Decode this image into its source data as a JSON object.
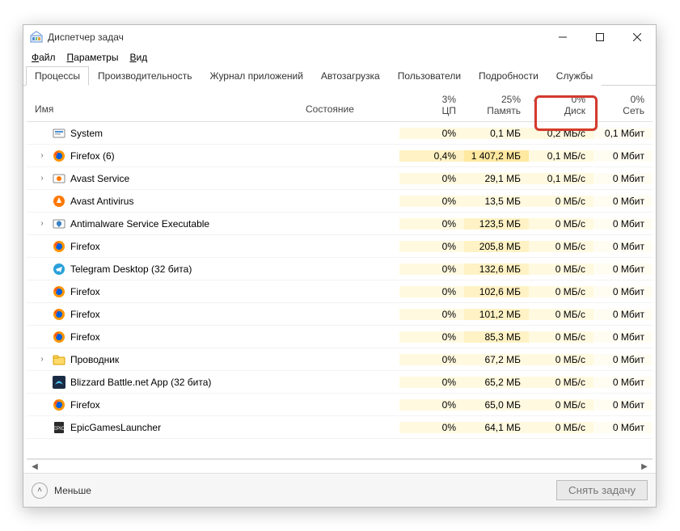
{
  "window": {
    "title": "Диспетчер задач"
  },
  "menu": {
    "file": "Файл",
    "options": "Параметры",
    "view": "Вид"
  },
  "tabs": {
    "processes": "Процессы",
    "performance": "Производительность",
    "app_history": "Журнал приложений",
    "startup": "Автозагрузка",
    "users": "Пользователи",
    "details": "Подробности",
    "services": "Службы"
  },
  "columns": {
    "name": "Имя",
    "status": "Состояние",
    "cpu_pct": "3%",
    "cpu_label": "ЦП",
    "mem_pct": "25%",
    "mem_label": "Память",
    "disk_pct": "0%",
    "disk_label": "Диск",
    "net_pct": "0%",
    "net_label": "Сеть"
  },
  "footer": {
    "fewer": "Меньше",
    "end_task": "Снять задачу"
  },
  "processes": [
    {
      "expand": false,
      "icon": "system",
      "name": "System",
      "cpu": "0%",
      "mem": "0,1 МБ",
      "disk": "0,2 МБ/с",
      "net": "0,1 Мбит"
    },
    {
      "expand": true,
      "icon": "firefox",
      "name": "Firefox (6)",
      "cpu": "0,4%",
      "mem": "1 407,2 МБ",
      "disk": "0,1 МБ/с",
      "net": "0 Мбит"
    },
    {
      "expand": true,
      "icon": "avastsvc",
      "name": "Avast Service",
      "cpu": "0%",
      "mem": "29,1 МБ",
      "disk": "0,1 МБ/с",
      "net": "0 Мбит"
    },
    {
      "expand": false,
      "icon": "avast",
      "name": "Avast Antivirus",
      "cpu": "0%",
      "mem": "13,5 МБ",
      "disk": "0 МБ/с",
      "net": "0 Мбит"
    },
    {
      "expand": true,
      "icon": "antimal",
      "name": "Antimalware Service Executable",
      "cpu": "0%",
      "mem": "123,5 МБ",
      "disk": "0 МБ/с",
      "net": "0 Мбит"
    },
    {
      "expand": false,
      "icon": "firefox",
      "name": "Firefox",
      "cpu": "0%",
      "mem": "205,8 МБ",
      "disk": "0 МБ/с",
      "net": "0 Мбит"
    },
    {
      "expand": false,
      "icon": "telegram",
      "name": "Telegram Desktop (32 бита)",
      "cpu": "0%",
      "mem": "132,6 МБ",
      "disk": "0 МБ/с",
      "net": "0 Мбит"
    },
    {
      "expand": false,
      "icon": "firefox",
      "name": "Firefox",
      "cpu": "0%",
      "mem": "102,6 МБ",
      "disk": "0 МБ/с",
      "net": "0 Мбит"
    },
    {
      "expand": false,
      "icon": "firefox",
      "name": "Firefox",
      "cpu": "0%",
      "mem": "101,2 МБ",
      "disk": "0 МБ/с",
      "net": "0 Мбит"
    },
    {
      "expand": false,
      "icon": "firefox",
      "name": "Firefox",
      "cpu": "0%",
      "mem": "85,3 МБ",
      "disk": "0 МБ/с",
      "net": "0 Мбит"
    },
    {
      "expand": true,
      "icon": "explorer",
      "name": "Проводник",
      "cpu": "0%",
      "mem": "67,2 МБ",
      "disk": "0 МБ/с",
      "net": "0 Мбит"
    },
    {
      "expand": false,
      "icon": "blizzard",
      "name": "Blizzard Battle.net App (32 бита)",
      "cpu": "0%",
      "mem": "65,2 МБ",
      "disk": "0 МБ/с",
      "net": "0 Мбит"
    },
    {
      "expand": false,
      "icon": "firefox",
      "name": "Firefox",
      "cpu": "0%",
      "mem": "65,0 МБ",
      "disk": "0 МБ/с",
      "net": "0 Мбит"
    },
    {
      "expand": false,
      "icon": "epic",
      "name": "EpicGamesLauncher",
      "cpu": "0%",
      "mem": "64,1 МБ",
      "disk": "0 МБ/с",
      "net": "0 Мбит"
    }
  ]
}
